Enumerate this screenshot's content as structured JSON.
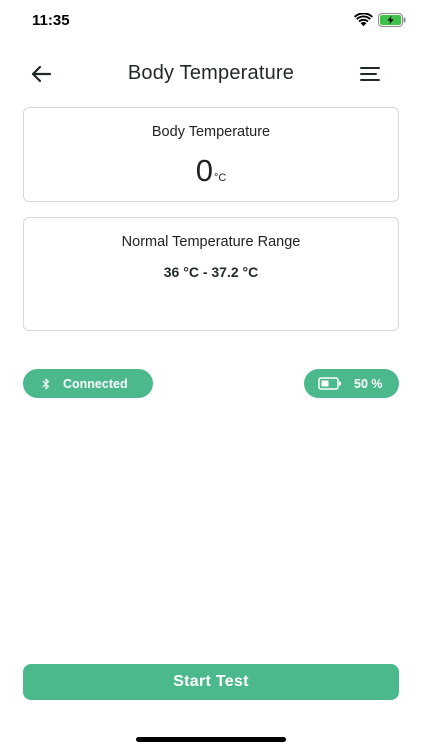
{
  "status_bar": {
    "time": "11:35",
    "wifi_icon": "wifi-icon",
    "battery_icon": "battery-charging-icon"
  },
  "header": {
    "title": "Body Temperature",
    "back_icon": "arrow-left-icon",
    "menu_icon": "hamburger-menu-icon"
  },
  "temperature_card": {
    "label": "Body Temperature",
    "value": "0",
    "unit": "°C"
  },
  "range_card": {
    "label": "Normal Temperature Range",
    "value": "36 °C - 37.2 °C"
  },
  "connection": {
    "icon": "bluetooth-icon",
    "label": "Connected"
  },
  "battery": {
    "icon": "battery-icon",
    "label": "50 %",
    "level_percent": 50
  },
  "actions": {
    "start_label": "Start Test"
  },
  "colors": {
    "accent": "#4bb98b",
    "text": "#1f2a22",
    "card_border": "#d6d9d7"
  }
}
